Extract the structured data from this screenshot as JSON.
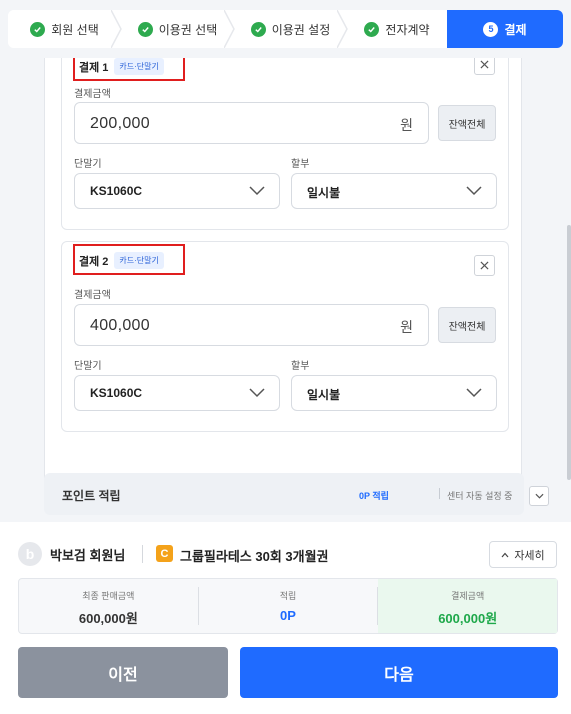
{
  "stepper": {
    "steps": [
      {
        "label": "회원 선택",
        "state": "done"
      },
      {
        "label": "이용권 선택",
        "state": "done"
      },
      {
        "label": "이용권 설정",
        "state": "done"
      },
      {
        "label": "전자계약",
        "state": "done"
      },
      {
        "label": "결제",
        "state": "active",
        "number": "5"
      }
    ],
    "done_color": "#2eaa4f",
    "active_color": "#1f6bff"
  },
  "payments": [
    {
      "title": "결제 1",
      "badge": "카드·단말기",
      "amount_label": "결제금액",
      "amount": "200,000",
      "unit": "원",
      "remain_button": "잔액전체",
      "terminal_label": "단말기",
      "terminal_value": "KS1060C",
      "installment_label": "할부",
      "installment_value": "일시불"
    },
    {
      "title": "결제 2",
      "badge": "카드·단말기",
      "amount_label": "결제금액",
      "amount": "400,000",
      "unit": "원",
      "remain_button": "잔액전체",
      "terminal_label": "단말기",
      "terminal_value": "KS1060C",
      "installment_label": "할부",
      "installment_value": "일시불"
    }
  ],
  "points": {
    "title": "포인트 적립",
    "earned": "0P 적립",
    "auto_setting": "센터 자동 설정 중"
  },
  "summary_bar": {
    "member_initial": "b",
    "member_name": "박보검 회원님",
    "ticket_icon": "C",
    "ticket_name": "그룹필라테스 30회 3개월권",
    "detail_button": "자세히",
    "final_price_label": "최종 판매금액",
    "final_price": "600,000원",
    "points_label": "적립",
    "points_value": "0P",
    "payment_label": "결제금액",
    "payment_value": "600,000원"
  },
  "buttons": {
    "prev": "이전",
    "next": "다음"
  },
  "colors": {
    "primary": "#1f6bff",
    "highlight_box": "#e01e1e",
    "success": "#1ea84a"
  }
}
